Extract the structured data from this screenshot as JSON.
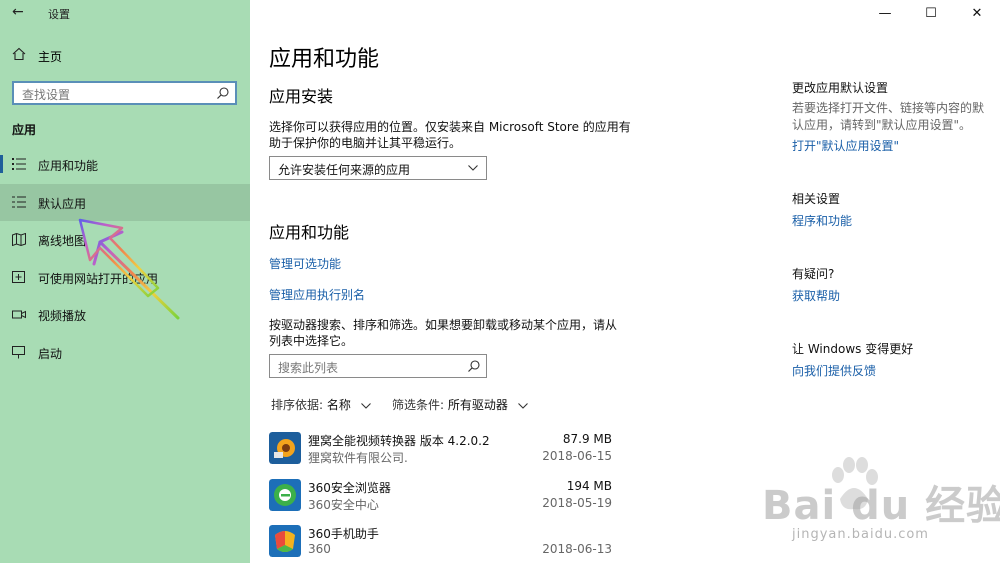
{
  "window": {
    "title": "设置",
    "controls": {
      "minimize": "—",
      "maximize": "☐",
      "close": "✕"
    }
  },
  "sidebar": {
    "home_label": "主页",
    "search_placeholder": "查找设置",
    "section_title": "应用",
    "items": [
      {
        "label": "应用和功能",
        "icon": "apps-list-icon"
      },
      {
        "label": "默认应用",
        "icon": "default-apps-icon"
      },
      {
        "label": "离线地图",
        "icon": "offline-maps-icon"
      },
      {
        "label": "可使用网站打开的应用",
        "icon": "apps-for-websites-icon"
      },
      {
        "label": "视频播放",
        "icon": "video-playback-icon"
      },
      {
        "label": "启动",
        "icon": "startup-icon"
      }
    ]
  },
  "main": {
    "title": "应用和功能",
    "install": {
      "heading": "应用安装",
      "description_line1": "选择你可以获得应用的位置。仅安装来自 Microsoft Store 的应用有",
      "description_line2": "助于保护你的电脑并让其平稳运行。",
      "dropdown_value": "允许安装任何来源的应用"
    },
    "apps": {
      "heading": "应用和功能",
      "link_optional": "管理可选功能",
      "link_alias": "管理应用执行别名",
      "description_line1": "按驱动器搜索、排序和筛选。如果想要卸载或移动某个应用，请从",
      "description_line2": "列表中选择它。",
      "search_placeholder": "搜索此列表",
      "sort_label": "排序依据:",
      "sort_value": "名称",
      "filter_label": "筛选条件:",
      "filter_value": "所有驱动器",
      "list": [
        {
          "name": "狸窝全能视频转换器 版本  4.2.0.2",
          "publisher": "狸窝软件有限公司.",
          "size": "87.9 MB",
          "date": "2018-06-15"
        },
        {
          "name": "360安全浏览器",
          "publisher": "360安全中心",
          "size": "194 MB",
          "date": "2018-05-19"
        },
        {
          "name": "360手机助手",
          "publisher": "360",
          "size": "",
          "date": "2018-06-13"
        }
      ]
    }
  },
  "right": {
    "default_heading": "更改应用默认设置",
    "default_text_line1": "若要选择打开文件、链接等内容的默",
    "default_text_line2": "认应用，请转到\"默认应用设置\"。",
    "default_link": "打开\"默认应用设置\"",
    "related_heading": "相关设置",
    "related_link": "程序和功能",
    "question_heading": "有疑问?",
    "question_link": "获取帮助",
    "feedback_heading": "让 Windows 变得更好",
    "feedback_link": "向我们提供反馈"
  },
  "watermark": {
    "brand": "Bai du 经验",
    "url": "jingyan.baidu.com"
  },
  "colors": {
    "sidebar_bg": "#a8dcb4",
    "link": "#1a5fa8",
    "accent_bar": "#1f5f9a"
  }
}
